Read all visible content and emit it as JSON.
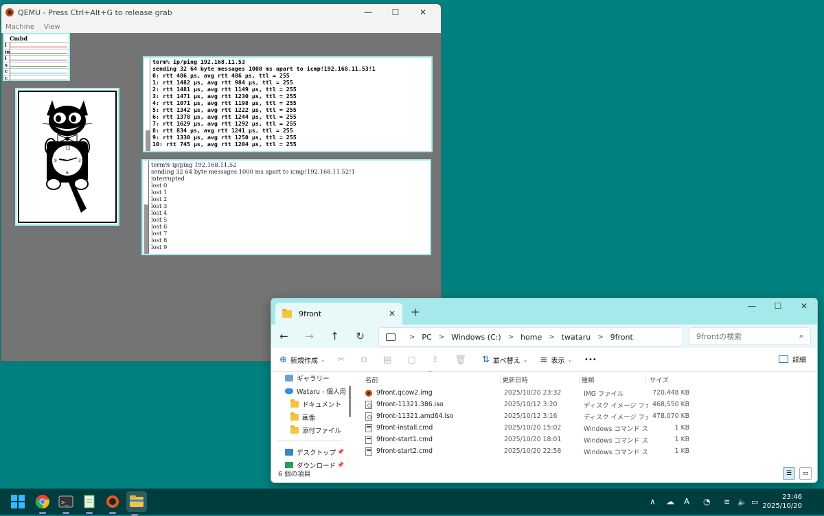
{
  "qemu": {
    "title": "QEMU - Press Ctrl+Alt+G to release grab",
    "menu": [
      "Machine",
      "View"
    ],
    "controls": {
      "minimize": "—",
      "maximize": "☐",
      "close": "✕"
    }
  },
  "stats": {
    "title": "Cmbd",
    "rows": [
      {
        "label": "l",
        "color": "#c33"
      },
      {
        "label": "m",
        "color": "#3a3"
      },
      {
        "label": "i",
        "color": "#55a"
      },
      {
        "label": "s",
        "color": "#393"
      },
      {
        "label": "c",
        "color": "#3af"
      },
      {
        "label": "c",
        "color": "#999"
      }
    ]
  },
  "term1": {
    "lines": [
      "term% ip/ping 192.168.11.53",
      "sending 32 64 byte messages 1000 ms apart to icmp!192.168.11.53!1",
      "0: rtt 486 µs, avg rtt 486 µs, ttl = 255",
      "1: rtt 1482 µs, avg rtt 984 µs, ttl = 255",
      "2: rtt 1481 µs, avg rtt 1149 µs, ttl = 255",
      "3: rtt 1471 µs, avg rtt 1230 µs, ttl = 255",
      "4: rtt 1071 µs, avg rtt 1198 µs, ttl = 255",
      "5: rtt 1342 µs, avg rtt 1222 µs, ttl = 255",
      "6: rtt 1378 µs, avg rtt 1244 µs, ttl = 255",
      "7: rtt 1629 µs, avg rtt 1292 µs, ttl = 255",
      "8: rtt 834 µs, avg rtt 1241 µs, ttl = 255",
      "9: rtt 1330 µs, avg rtt 1250 µs, ttl = 255",
      "10: rtt 745 µs, avg rtt 1204 µs, ttl = 255"
    ]
  },
  "term2": {
    "lines": [
      "term% ip/ping 192.168.11.52",
      "sending 32 64 byte messages 1000 ms apart to icmp!192.168.11.52!1",
      "interrupted",
      "lost 0",
      "lost 1",
      "lost 2",
      "lost 3",
      "lost 4",
      "lost 5",
      "lost 6",
      "lost 7",
      "lost 8",
      "lost 9"
    ]
  },
  "explorer": {
    "tab_title": "9front",
    "tab_close": "✕",
    "new_tab": "+",
    "controls": {
      "minimize": "—",
      "maximize": "☐",
      "close": "✕"
    },
    "nav": {
      "back": "←",
      "forward": "→",
      "up": "↑",
      "refresh": "↻"
    },
    "breadcrumb": [
      "PC",
      "Windows (C:)",
      "home",
      "twataru",
      "9front"
    ],
    "breadcrumb_sep": ">",
    "search_placeholder": "9frontの検索",
    "commands": {
      "new": "新規作成",
      "sort": "並べ替え",
      "view": "表示",
      "more": "•••",
      "details": "詳細"
    },
    "sidebar": [
      {
        "label": "ギャラリー",
        "icon": "gallery-icon"
      },
      {
        "label": "Wataru - 個人用",
        "icon": "onedrive-icon"
      },
      {
        "label": "ドキュメント",
        "icon": "folder-icon"
      },
      {
        "label": "画像",
        "icon": "folder-icon"
      },
      {
        "label": "添付ファイル",
        "icon": "folder-icon"
      },
      {
        "label": "デスクトップ",
        "icon": "desktop-icon"
      },
      {
        "label": "ダウンロード",
        "icon": "download-icon"
      }
    ],
    "columns": {
      "name": "名前",
      "date": "更新日時",
      "type": "種類",
      "size": "サイズ"
    },
    "files": [
      {
        "name": "9front.qcow2.img",
        "date": "2025/10/20 23:32",
        "type": "IMG ファイル",
        "size": "720,448 KB",
        "icon": "img"
      },
      {
        "name": "9front-11321.386.iso",
        "date": "2025/10/12 3:20",
        "type": "ディスク イメージ ファ...",
        "size": "468,550 KB",
        "icon": "iso"
      },
      {
        "name": "9front-11321.amd64.iso",
        "date": "2025/10/12 3:16",
        "type": "ディスク イメージ ファ...",
        "size": "478,070 KB",
        "icon": "iso"
      },
      {
        "name": "9front-install.cmd",
        "date": "2025/10/20 15:02",
        "type": "Windows コマンド ス...",
        "size": "1 KB",
        "icon": "cmd"
      },
      {
        "name": "9front-start1.cmd",
        "date": "2025/10/20 18:01",
        "type": "Windows コマンド ス...",
        "size": "1 KB",
        "icon": "cmd"
      },
      {
        "name": "9front-start2.cmd",
        "date": "2025/10/20 22:58",
        "type": "Windows コマンド ス...",
        "size": "1 KB",
        "icon": "cmd"
      }
    ],
    "status": "6 個の項目"
  },
  "taskbar": {
    "ime": "A",
    "time": "23:46",
    "date": "2025/10/20"
  }
}
